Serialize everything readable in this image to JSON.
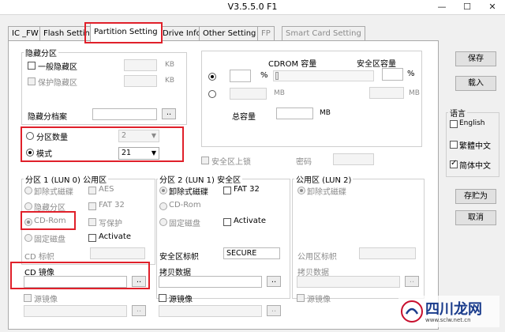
{
  "window": {
    "title": "V3.5.5.0 F1",
    "minimize": "—",
    "maximize": "☐",
    "close": "✕"
  },
  "tabs": [
    {
      "label": "IC _FW"
    },
    {
      "label": "Flash Setting"
    },
    {
      "label": "Partition Setting"
    },
    {
      "label": "Drive Info"
    },
    {
      "label": "Other Setting"
    },
    {
      "label": "FP"
    },
    {
      "label": "Smart Card Setting"
    }
  ],
  "hidden": {
    "group_label": "隐藏分区",
    "normal_label": "一般隐藏区",
    "protect_label": "保护隐藏区",
    "unit1": "KB",
    "unit2": "KB",
    "file_label": "隐藏分档案",
    "browse": ".."
  },
  "cdrom": {
    "capacity_label": "CDROM 容量",
    "secure_label": "安全区容量",
    "percent": "%",
    "mb1": "MB",
    "mb2": "MB",
    "total_label": "总容量",
    "mb3": "MB"
  },
  "partition": {
    "count_label": "分区数量",
    "count_value": "2",
    "mode_label": "模式",
    "mode_value": "21"
  },
  "lock": {
    "label": "安全区上锁",
    "password_label": "密码"
  },
  "part1": {
    "group_label": "分区 1 (LUN 0) 公用区",
    "removable": "卸除式磁碟",
    "hidden": "隐藏分区",
    "cdrom": "CD-Rom",
    "fixed": "固定磁盘",
    "aes": "AES",
    "fat32": "FAT 32",
    "write_protect": "写保护",
    "activate": "Activate",
    "cd_label": "CD 标帜"
  },
  "part2": {
    "group_label": "分区 2 (LUN 1) 安全区",
    "removable": "卸除式磁碟",
    "cdrom": "CD-Rom",
    "fixed": "固定磁盘",
    "fat32": "FAT 32",
    "activate": "Activate",
    "secure_label": "安全区标帜",
    "secure_value": "SECURE",
    "copy_label": "拷贝数据",
    "browse": "..",
    "source_label": "源镜像",
    "browse2": ".."
  },
  "part3": {
    "group_label": "公用区 (LUN 2)",
    "removable": "卸除式磁碟",
    "public_label": "公用区标帜",
    "copy_label": "拷贝数据",
    "browse": "..",
    "source_label": "源镜像"
  },
  "cd_image": {
    "label": "CD 镜像",
    "browse": "..",
    "source_label": "源镜像",
    "browse2": ".."
  },
  "right": {
    "save": "保存",
    "load": "载入",
    "lang_label": "语言",
    "english": "English",
    "trad": "繁體中文",
    "simp": "简体中文",
    "save_as": "存贮为",
    "cancel": "取消"
  },
  "watermark": {
    "text": "四川龙网",
    "sub": "www.sclw.net.cn"
  },
  "colors": {
    "highlight": "#e0202a"
  }
}
